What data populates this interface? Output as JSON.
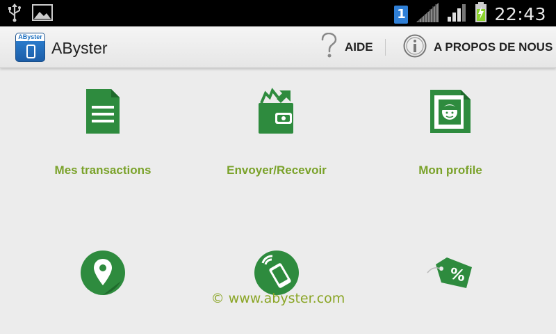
{
  "status_bar": {
    "time": "22:43",
    "sim_number": "1",
    "icons": [
      "usb-icon",
      "image-icon",
      "sim-icon",
      "signal-icon",
      "signal-icon",
      "battery-charging-icon"
    ]
  },
  "action_bar": {
    "app_title": "AByster",
    "app_logo_text": "AByster",
    "help_label": "AIDE",
    "about_label": "A PROPOS DE NOUS"
  },
  "tiles": [
    {
      "label": "Mes transactions",
      "icon": "document-icon"
    },
    {
      "label": "Envoyer/Recevoir",
      "icon": "wallet-transfer-icon"
    },
    {
      "label": "Mon profile",
      "icon": "profile-icon"
    },
    {
      "label": "",
      "icon": "map-pin-icon"
    },
    {
      "label": "",
      "icon": "nfc-phone-icon"
    },
    {
      "label": "",
      "icon": "discount-tag-icon"
    }
  ],
  "footer": {
    "text": "© www.abyster.com"
  },
  "colors": {
    "accent_green": "#2e8b3e",
    "label_green": "#7aa22a",
    "status_bar": "#000000"
  }
}
